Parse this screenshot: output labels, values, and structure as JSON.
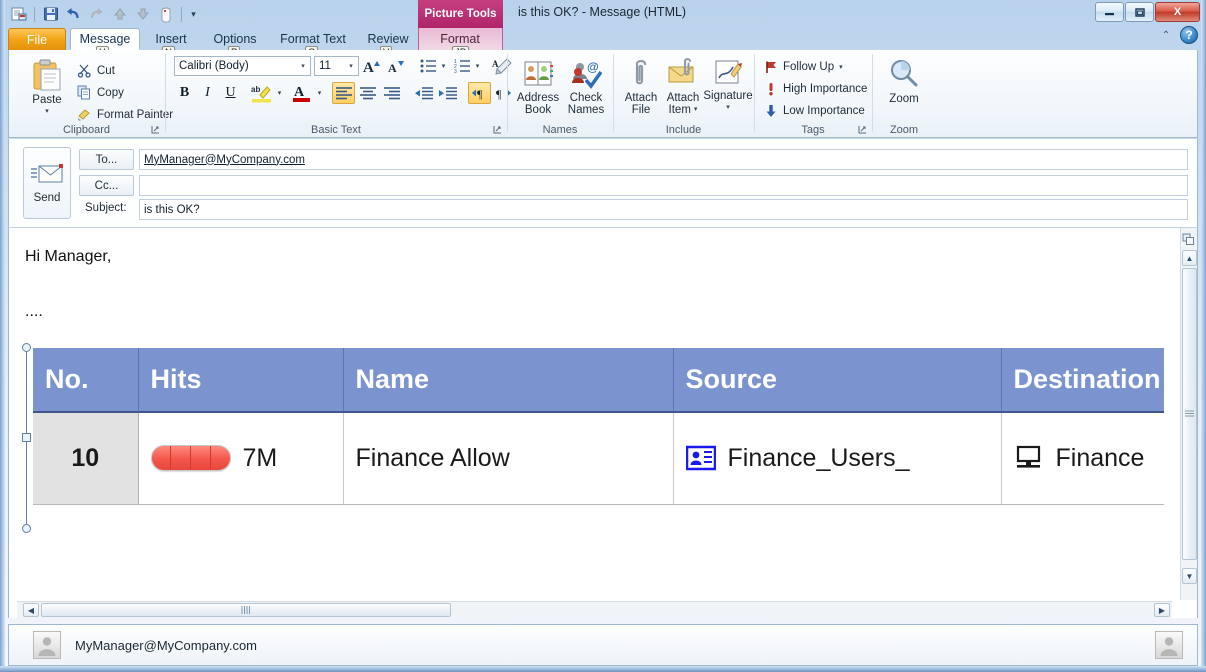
{
  "window": {
    "title": "is this OK?  -  Message (HTML)",
    "contextual_tools_label": "Picture Tools",
    "minimize_label": "—",
    "restore_label": "❐",
    "close_label": "X",
    "help_label": "?",
    "ribbon_collapse_label": "⌃"
  },
  "quick_access": {
    "items": [
      {
        "name": "outlook-options-icon",
        "label": ""
      },
      {
        "name": "save-icon",
        "label": ""
      },
      {
        "name": "undo-icon",
        "label": ""
      },
      {
        "name": "redo-icon",
        "label": ""
      },
      {
        "name": "previous-item-icon",
        "label": ""
      },
      {
        "name": "next-item-icon",
        "label": ""
      },
      {
        "name": "attach-icon",
        "label": ""
      }
    ],
    "customize_label": "▾"
  },
  "tabs": [
    {
      "label": "File",
      "keytip": "",
      "active": false,
      "kind": "file"
    },
    {
      "label": "Message",
      "keytip": "H",
      "active": true,
      "kind": "normal"
    },
    {
      "label": "Insert",
      "keytip": "N",
      "active": false,
      "kind": "normal"
    },
    {
      "label": "Options",
      "keytip": "P",
      "active": false,
      "kind": "normal"
    },
    {
      "label": "Format Text",
      "keytip": "O",
      "active": false,
      "kind": "normal"
    },
    {
      "label": "Review",
      "keytip": "V",
      "active": false,
      "kind": "normal"
    },
    {
      "label": "Format",
      "keytip": "JP",
      "active": false,
      "kind": "contextual"
    }
  ],
  "ribbon": {
    "groups": [
      {
        "name": "clipboard",
        "label": "Clipboard"
      },
      {
        "name": "basic-text",
        "label": "Basic Text"
      },
      {
        "name": "names",
        "label": "Names"
      },
      {
        "name": "include",
        "label": "Include"
      },
      {
        "name": "tags",
        "label": "Tags"
      },
      {
        "name": "zoom",
        "label": "Zoom"
      }
    ],
    "clipboard": {
      "paste_label": "Paste",
      "paste_arrow": "▾",
      "cut_label": "Cut",
      "copy_label": "Copy",
      "format_painter_label": "Format Painter"
    },
    "basic_text": {
      "font_value": "Calibri (Body)",
      "font_size_value": "11",
      "grow_font_label": "A",
      "shrink_font_label": "A",
      "bullets_label": "•",
      "numbering_label": "1",
      "clear_formatting_label": "",
      "bold_label": "B",
      "italic_label": "I",
      "underline_label": "U",
      "highlight_label": "ab",
      "font_color_label": "A",
      "align_left_label": "",
      "align_center_label": "",
      "align_right_label": "",
      "decrease_indent_label": "",
      "increase_indent_label": "",
      "ltr_label": "¶",
      "rtl_label": "¶",
      "dropdown_arrow": "▾"
    },
    "names": {
      "address_book_line1": "Address",
      "address_book_line2": "Book",
      "check_names_line1": "Check",
      "check_names_line2": "Names"
    },
    "include": {
      "attach_file_line1": "Attach",
      "attach_file_line2": "File",
      "attach_item_line1": "Attach",
      "attach_item_line2": "Item",
      "attach_item_arrow": "▾",
      "signature_label": "Signature",
      "signature_arrow": "▾"
    },
    "tags": {
      "follow_up_label": "Follow Up",
      "follow_up_arrow": "▾",
      "high_importance_label": "High Importance",
      "low_importance_label": "Low Importance"
    },
    "zoom": {
      "zoom_label": "Zoom"
    }
  },
  "compose": {
    "send_label": "Send",
    "to_button_label": "To...",
    "cc_button_label": "Cc...",
    "subject_label": "Subject:",
    "to_value": "MyManager@MyCompany.com",
    "cc_value": "",
    "subject_value": "is this OK?"
  },
  "body": {
    "greeting": "Hi Manager,",
    "filler": "...."
  },
  "table_image": {
    "headers": [
      "No.",
      "Hits",
      "Name",
      "Source",
      "Destination"
    ],
    "rows": [
      {
        "no": "10",
        "hits_value": "7M",
        "hits_segments": 4,
        "hits_bar_color": "#f4564a",
        "name": "Finance Allow",
        "source_icon": "contact-card-icon",
        "source": "Finance_Users_",
        "destination_icon": "computer-icon",
        "destination": "Finance"
      }
    ]
  },
  "scrollbars": {
    "up_arrow": "▲",
    "down_arrow": "▼",
    "left_arrow": "◀",
    "right_arrow": "▶",
    "grip": "≡"
  },
  "statusbar": {
    "email": "MyManager@MyCompany.com"
  }
}
